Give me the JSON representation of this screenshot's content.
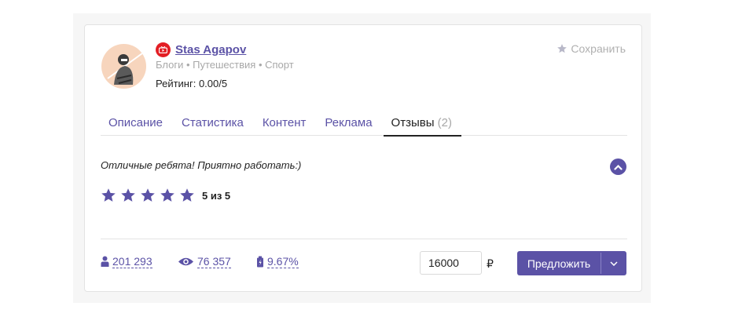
{
  "channel": {
    "name": "Stas Agapov",
    "categories": "Блоги • Путешествия • Спорт",
    "rating": "Рейтинг: 0.00/5",
    "platform_icon": "youtube-icon",
    "platform_color": "#e31e24"
  },
  "save": {
    "label": "Сохранить",
    "icon": "star-icon"
  },
  "tabs": [
    {
      "label": "Описание"
    },
    {
      "label": "Статистика"
    },
    {
      "label": "Контент"
    },
    {
      "label": "Реклама"
    },
    {
      "label": "Отзывы",
      "count": "(2)",
      "active": true
    }
  ],
  "review": {
    "text": "Отличные ребята! Приятно работать:)",
    "stars": 5,
    "score": "5 из 5"
  },
  "stats": {
    "subscribers": "201 293",
    "views": "76 357",
    "engagement": "9.67%"
  },
  "offer": {
    "price_value": "16000",
    "currency": "₽",
    "button_label": "Предложить"
  },
  "colors": {
    "accent": "#5b52a6",
    "muted": "#a8a8a8"
  }
}
